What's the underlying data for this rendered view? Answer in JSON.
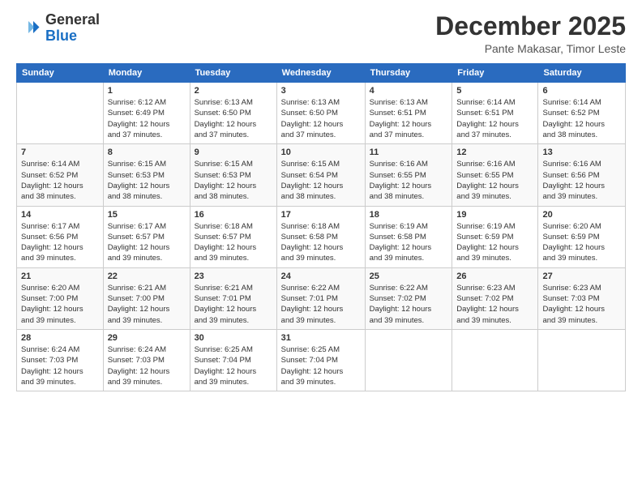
{
  "logo": {
    "general": "General",
    "blue": "Blue"
  },
  "header": {
    "month": "December 2025",
    "location": "Pante Makasar, Timor Leste"
  },
  "weekdays": [
    "Sunday",
    "Monday",
    "Tuesday",
    "Wednesday",
    "Thursday",
    "Friday",
    "Saturday"
  ],
  "weeks": [
    [
      {
        "day": "",
        "info": ""
      },
      {
        "day": "1",
        "info": "Sunrise: 6:12 AM\nSunset: 6:49 PM\nDaylight: 12 hours\nand 37 minutes."
      },
      {
        "day": "2",
        "info": "Sunrise: 6:13 AM\nSunset: 6:50 PM\nDaylight: 12 hours\nand 37 minutes."
      },
      {
        "day": "3",
        "info": "Sunrise: 6:13 AM\nSunset: 6:50 PM\nDaylight: 12 hours\nand 37 minutes."
      },
      {
        "day": "4",
        "info": "Sunrise: 6:13 AM\nSunset: 6:51 PM\nDaylight: 12 hours\nand 37 minutes."
      },
      {
        "day": "5",
        "info": "Sunrise: 6:14 AM\nSunset: 6:51 PM\nDaylight: 12 hours\nand 37 minutes."
      },
      {
        "day": "6",
        "info": "Sunrise: 6:14 AM\nSunset: 6:52 PM\nDaylight: 12 hours\nand 38 minutes."
      }
    ],
    [
      {
        "day": "7",
        "info": "Sunrise: 6:14 AM\nSunset: 6:52 PM\nDaylight: 12 hours\nand 38 minutes."
      },
      {
        "day": "8",
        "info": "Sunrise: 6:15 AM\nSunset: 6:53 PM\nDaylight: 12 hours\nand 38 minutes."
      },
      {
        "day": "9",
        "info": "Sunrise: 6:15 AM\nSunset: 6:53 PM\nDaylight: 12 hours\nand 38 minutes."
      },
      {
        "day": "10",
        "info": "Sunrise: 6:15 AM\nSunset: 6:54 PM\nDaylight: 12 hours\nand 38 minutes."
      },
      {
        "day": "11",
        "info": "Sunrise: 6:16 AM\nSunset: 6:55 PM\nDaylight: 12 hours\nand 38 minutes."
      },
      {
        "day": "12",
        "info": "Sunrise: 6:16 AM\nSunset: 6:55 PM\nDaylight: 12 hours\nand 39 minutes."
      },
      {
        "day": "13",
        "info": "Sunrise: 6:16 AM\nSunset: 6:56 PM\nDaylight: 12 hours\nand 39 minutes."
      }
    ],
    [
      {
        "day": "14",
        "info": "Sunrise: 6:17 AM\nSunset: 6:56 PM\nDaylight: 12 hours\nand 39 minutes."
      },
      {
        "day": "15",
        "info": "Sunrise: 6:17 AM\nSunset: 6:57 PM\nDaylight: 12 hours\nand 39 minutes."
      },
      {
        "day": "16",
        "info": "Sunrise: 6:18 AM\nSunset: 6:57 PM\nDaylight: 12 hours\nand 39 minutes."
      },
      {
        "day": "17",
        "info": "Sunrise: 6:18 AM\nSunset: 6:58 PM\nDaylight: 12 hours\nand 39 minutes."
      },
      {
        "day": "18",
        "info": "Sunrise: 6:19 AM\nSunset: 6:58 PM\nDaylight: 12 hours\nand 39 minutes."
      },
      {
        "day": "19",
        "info": "Sunrise: 6:19 AM\nSunset: 6:59 PM\nDaylight: 12 hours\nand 39 minutes."
      },
      {
        "day": "20",
        "info": "Sunrise: 6:20 AM\nSunset: 6:59 PM\nDaylight: 12 hours\nand 39 minutes."
      }
    ],
    [
      {
        "day": "21",
        "info": "Sunrise: 6:20 AM\nSunset: 7:00 PM\nDaylight: 12 hours\nand 39 minutes."
      },
      {
        "day": "22",
        "info": "Sunrise: 6:21 AM\nSunset: 7:00 PM\nDaylight: 12 hours\nand 39 minutes."
      },
      {
        "day": "23",
        "info": "Sunrise: 6:21 AM\nSunset: 7:01 PM\nDaylight: 12 hours\nand 39 minutes."
      },
      {
        "day": "24",
        "info": "Sunrise: 6:22 AM\nSunset: 7:01 PM\nDaylight: 12 hours\nand 39 minutes."
      },
      {
        "day": "25",
        "info": "Sunrise: 6:22 AM\nSunset: 7:02 PM\nDaylight: 12 hours\nand 39 minutes."
      },
      {
        "day": "26",
        "info": "Sunrise: 6:23 AM\nSunset: 7:02 PM\nDaylight: 12 hours\nand 39 minutes."
      },
      {
        "day": "27",
        "info": "Sunrise: 6:23 AM\nSunset: 7:03 PM\nDaylight: 12 hours\nand 39 minutes."
      }
    ],
    [
      {
        "day": "28",
        "info": "Sunrise: 6:24 AM\nSunset: 7:03 PM\nDaylight: 12 hours\nand 39 minutes."
      },
      {
        "day": "29",
        "info": "Sunrise: 6:24 AM\nSunset: 7:03 PM\nDaylight: 12 hours\nand 39 minutes."
      },
      {
        "day": "30",
        "info": "Sunrise: 6:25 AM\nSunset: 7:04 PM\nDaylight: 12 hours\nand 39 minutes."
      },
      {
        "day": "31",
        "info": "Sunrise: 6:25 AM\nSunset: 7:04 PM\nDaylight: 12 hours\nand 39 minutes."
      },
      {
        "day": "",
        "info": ""
      },
      {
        "day": "",
        "info": ""
      },
      {
        "day": "",
        "info": ""
      }
    ]
  ]
}
